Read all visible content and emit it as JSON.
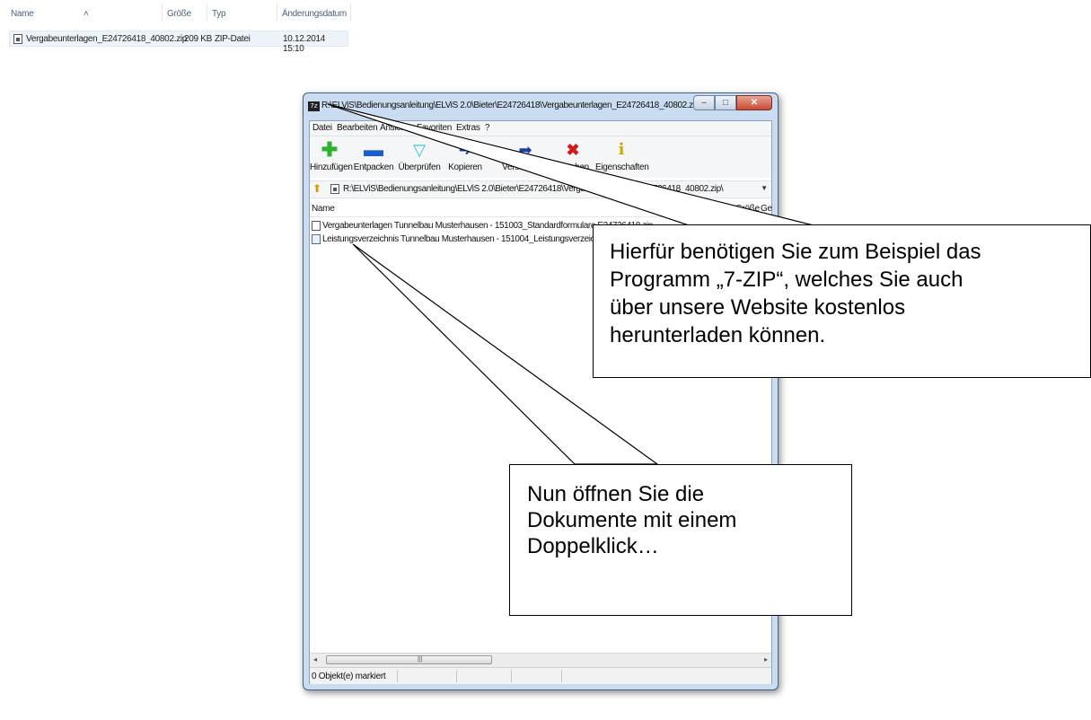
{
  "explorer": {
    "columns": {
      "name": "Name",
      "size": "Größe",
      "type": "Typ",
      "date": "Änderungsdatum"
    },
    "file": {
      "name": "Vergabeunterlagen_E24726418_40802.zip",
      "size": "209 KB",
      "type": "ZIP-Datei",
      "date": "10.12.2014 15:10"
    }
  },
  "window": {
    "title": "R:\\ELViS\\Bedienungsanleitung\\ELViS 2.0\\Bieter\\E24726418\\Vergabeunterlagen_E24726418_40802.zip\\",
    "app_icon": "7z",
    "menu": [
      "Datei",
      "Bearbeiten",
      "Ansicht",
      "Favoriten",
      "Extras",
      "?"
    ],
    "toolbar": [
      {
        "label": "Hinzufügen",
        "icon": "add-icon"
      },
      {
        "label": "Entpacken",
        "icon": "extract-icon"
      },
      {
        "label": "Überprüfen",
        "icon": "test-icon"
      },
      {
        "label": "Kopieren",
        "icon": "copy-icon"
      },
      {
        "label": "Verschieben",
        "icon": "move-icon"
      },
      {
        "label": "Löschen",
        "icon": "delete-icon"
      },
      {
        "label": "Eigenschaften",
        "icon": "info-icon"
      }
    ],
    "address": "R:\\ELViS\\Bedienungsanleitung\\ELViS 2.0\\Bieter\\E24726418\\Vergabeunterlagen_E24726418_40802.zip\\",
    "list_columns": {
      "name": "Name",
      "size": "Größe",
      "packed": "Ge"
    },
    "files": [
      "Vergabeunterlagen Tunnelbau Musterhausen - 151003_Standardformulare E24726418.zip",
      "Leistungsverzeichnis Tunnelbau Musterhausen - 151004_Leistungsverzeichnis.doc"
    ],
    "status": "0 Objekt(e) markiert"
  },
  "callouts": {
    "top": [
      "Hierfür benötigen Sie zum Beispiel das",
      "Programm „7-ZIP“, welches Sie auch",
      "über unsere Website kostenlos",
      "herunterladen können."
    ],
    "bottom": [
      "Nun öffnen Sie die",
      "Dokumente mit einem",
      "Doppelklick…"
    ]
  },
  "colors": {
    "window_frame": "#c9dcf1",
    "add": "#2fb12f",
    "extract": "#1a5ec9",
    "test": "#27c6d4",
    "move": "#1a3ea8",
    "delete": "#d11a1a",
    "info": "#d4a700"
  }
}
